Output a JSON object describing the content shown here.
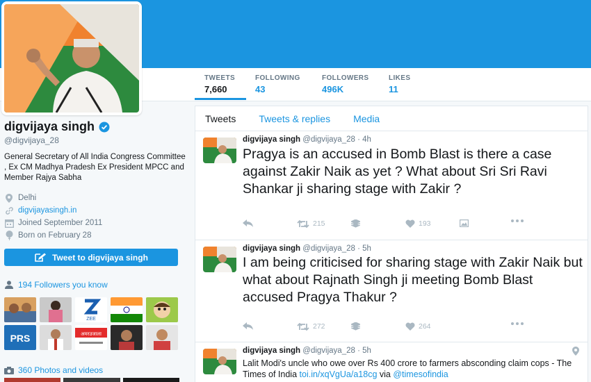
{
  "profile": {
    "name": "digvijaya singh",
    "handle": "@digvijaya_28",
    "bio": "General Secretary of All India Congress Committee , Ex CM Madhya Pradesh Ex President MPCC and Member Rajya Sabha",
    "location": "Delhi",
    "website": "digvijayasingh.in",
    "joined": "Joined September 2011",
    "born": "Born on February 28",
    "tweet_to_label": "Tweet to digvijaya singh",
    "followers_you_know": "194 Followers you know",
    "photos_videos": "360 Photos and videos"
  },
  "stats": [
    {
      "label": "TWEETS",
      "value": "7,660"
    },
    {
      "label": "FOLLOWING",
      "value": "43"
    },
    {
      "label": "FOLLOWERS",
      "value": "496K"
    },
    {
      "label": "LIKES",
      "value": "11"
    }
  ],
  "tabs": [
    "Tweets",
    "Tweets & replies",
    "Media"
  ],
  "tweets": [
    {
      "name": "digvijaya singh",
      "handle": "@digvijaya_28",
      "time": "· 4h",
      "text": "Pragya is an accused in Bomb Blast is there a case against Zakir Naik as yet ? What about Sri Sri Ravi Shankar ji sharing stage with Zakir ?",
      "retweets": "215",
      "likes": "193"
    },
    {
      "name": "digvijaya singh",
      "handle": "@digvijaya_28",
      "time": "· 5h",
      "text": "I am being criticised for sharing stage with Zakir Naik but what about Rajnath Singh ji meeting Bomb Blast accused Pragya Thakur ?",
      "retweets": "272",
      "likes": "264"
    },
    {
      "name": "digvijaya singh",
      "handle": "@digvijaya_28",
      "time": "· 5h",
      "text_plain": "Lalit Modi's uncle who owe over Rs 400 crore to farmers absconding claim cops - The Times of India ",
      "link": "toi.in/xqVgUa/a18cg",
      "via": " via ",
      "mention": "@timesofindia"
    }
  ],
  "follower_thumbs": [
    {
      "label": "ZEE"
    },
    {
      "label": "PRS"
    },
    {
      "label": "अमरउजाला"
    }
  ],
  "colors": {
    "accent": "#1b95e0",
    "banner": "#1b95e0",
    "text": "#14171a",
    "muted": "#657786",
    "icon": "#aab8c2",
    "background": "#f5f8fa"
  },
  "icons": [
    "verified-badge-icon",
    "location-pin-icon",
    "link-icon",
    "calendar-icon",
    "balloon-icon",
    "compose-icon",
    "person-icon",
    "camera-icon",
    "reply-icon",
    "retweet-icon",
    "stack-icon",
    "heart-icon",
    "picture-icon",
    "more-icon"
  ]
}
